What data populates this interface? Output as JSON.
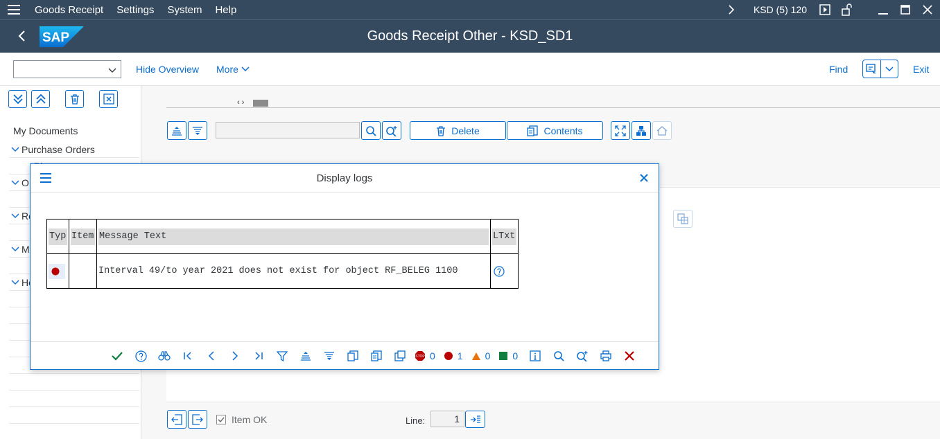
{
  "menubar": {
    "items": [
      "Goods Receipt",
      "Settings",
      "System",
      "Help"
    ],
    "system_info": "KSD (5) 120"
  },
  "titlebar": {
    "logo_text": "SAP",
    "title": "Goods Receipt Other - KSD_SD1"
  },
  "toolbar": {
    "okcode_value": "",
    "hide_overview": "Hide Overview",
    "more": "More",
    "find": "Find",
    "exit": "Exit"
  },
  "leftpanel": {
    "header": "My Documents",
    "tree": [
      {
        "label": "Purchase Orders"
      },
      {
        "label": "Pl"
      },
      {
        "label": "O"
      },
      {
        "label": ""
      },
      {
        "label": "Re"
      },
      {
        "label": ""
      },
      {
        "label": "M"
      },
      {
        "label": ""
      },
      {
        "label": "He"
      }
    ]
  },
  "main": {
    "delete_label": "Delete",
    "contents_label": "Contents",
    "search_value": "",
    "item_ok_label": "Item OK",
    "line_label": "Line:",
    "line_value": "1"
  },
  "dialog": {
    "title": "Display logs",
    "table": {
      "headers": [
        "Typ",
        "Item",
        "Message Text",
        "LTxt"
      ],
      "rows": [
        {
          "type": "error",
          "item": "",
          "message": "Interval 49/to year 2021 does not exist for object RF_BELEG 1100"
        }
      ]
    },
    "counts": {
      "stop": "0",
      "error": "1",
      "warning": "0",
      "success": "0"
    }
  },
  "colors": {
    "shell": "#354a5f",
    "accent": "#0a6ed1",
    "error": "#bb0000",
    "warning": "#e9730c",
    "success": "#107e3e"
  }
}
